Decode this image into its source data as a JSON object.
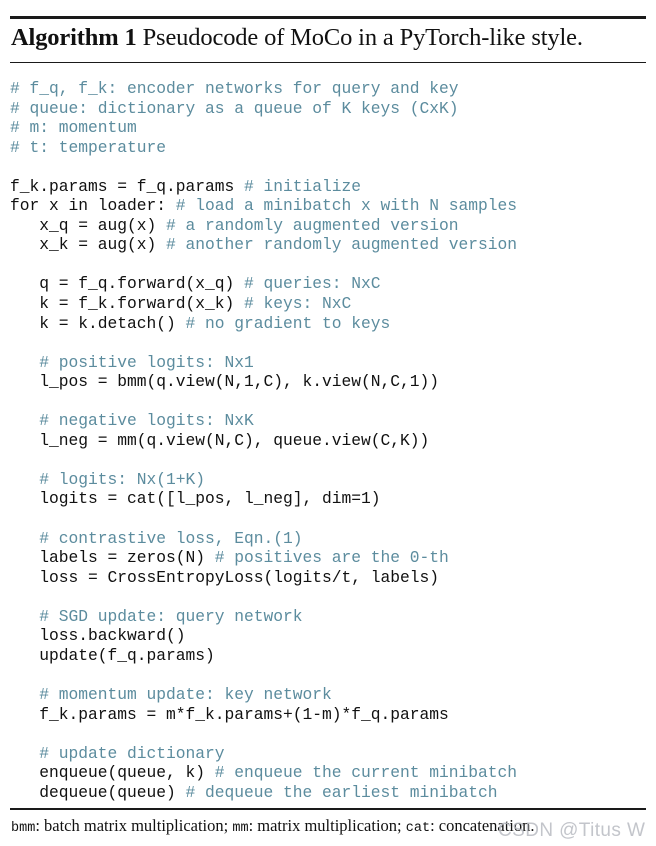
{
  "document": {
    "type": "algorithm-figure",
    "title_label": "Algorithm 1",
    "title_caption": " Pseudocode of MoCo in a PyTorch-like style.",
    "colors": {
      "comment": "#5c8c9e",
      "code": "#111111",
      "rule": "#1a1a1a",
      "watermark": "#b9bcc2",
      "background": "#ffffff"
    }
  },
  "code": {
    "language": "python-pseudocode",
    "lines": [
      {
        "code": "",
        "comment": "# f_q, f_k: encoder networks for query and key"
      },
      {
        "code": "",
        "comment": "# queue: dictionary as a queue of K keys (CxK)"
      },
      {
        "code": "",
        "comment": "# m: momentum"
      },
      {
        "code": "",
        "comment": "# t: temperature"
      },
      {
        "code": "",
        "comment": ""
      },
      {
        "code": "f_k.params = f_q.params ",
        "comment": "# initialize"
      },
      {
        "code": "for x in loader: ",
        "comment": "# load a minibatch x with N samples"
      },
      {
        "code": "   x_q = aug(x) ",
        "comment": "# a randomly augmented version"
      },
      {
        "code": "   x_k = aug(x) ",
        "comment": "# another randomly augmented version"
      },
      {
        "code": "",
        "comment": ""
      },
      {
        "code": "   q = f_q.forward(x_q) ",
        "comment": "# queries: NxC"
      },
      {
        "code": "   k = f_k.forward(x_k) ",
        "comment": "# keys: NxC"
      },
      {
        "code": "   k = k.detach() ",
        "comment": "# no gradient to keys"
      },
      {
        "code": "",
        "comment": ""
      },
      {
        "code": "   ",
        "comment": "# positive logits: Nx1"
      },
      {
        "code": "   l_pos = bmm(q.view(N,1,C), k.view(N,C,1))",
        "comment": ""
      },
      {
        "code": "",
        "comment": ""
      },
      {
        "code": "   ",
        "comment": "# negative logits: NxK"
      },
      {
        "code": "   l_neg = mm(q.view(N,C), queue.view(C,K))",
        "comment": ""
      },
      {
        "code": "",
        "comment": ""
      },
      {
        "code": "   ",
        "comment": "# logits: Nx(1+K)"
      },
      {
        "code": "   logits = cat([l_pos, l_neg], dim=1)",
        "comment": ""
      },
      {
        "code": "",
        "comment": ""
      },
      {
        "code": "   ",
        "comment": "# contrastive loss, Eqn.(1)"
      },
      {
        "code": "   labels = zeros(N) ",
        "comment": "# positives are the 0-th"
      },
      {
        "code": "   loss = CrossEntropyLoss(logits/t, labels)",
        "comment": ""
      },
      {
        "code": "",
        "comment": ""
      },
      {
        "code": "   ",
        "comment": "# SGD update: query network"
      },
      {
        "code": "   loss.backward()",
        "comment": ""
      },
      {
        "code": "   update(f_q.params)",
        "comment": ""
      },
      {
        "code": "",
        "comment": ""
      },
      {
        "code": "   ",
        "comment": "# momentum update: key network"
      },
      {
        "code": "   f_k.params = m*f_k.params+(1-m)*f_q.params",
        "comment": ""
      },
      {
        "code": "",
        "comment": ""
      },
      {
        "code": "   ",
        "comment": "# update dictionary"
      },
      {
        "code": "   enqueue(queue, k) ",
        "comment": "# enqueue the current minibatch"
      },
      {
        "code": "   dequeue(queue) ",
        "comment": "# dequeue the earliest minibatch"
      }
    ]
  },
  "footer": {
    "terms": [
      {
        "name": "bmm",
        "definition": ": batch matrix multiplication; "
      },
      {
        "name": "mm",
        "definition": ": matrix multiplication; "
      },
      {
        "name": "cat",
        "definition": ": concatenation."
      }
    ]
  },
  "watermark": {
    "text": "CSDN @Titus W"
  }
}
